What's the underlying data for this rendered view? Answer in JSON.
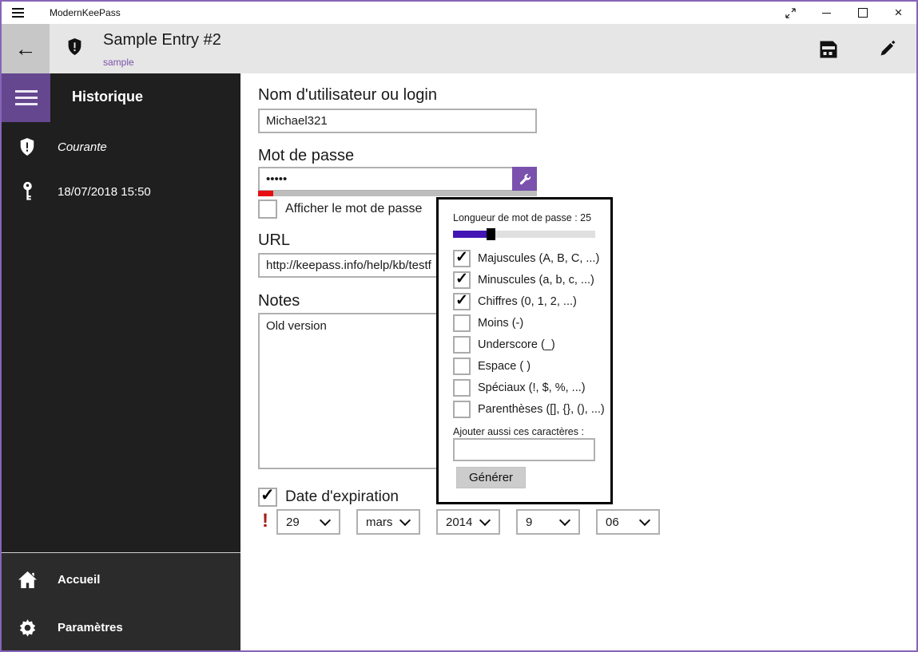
{
  "titlebar": {
    "app_title": "ModernKeePass"
  },
  "header": {
    "entry_title": "Sample Entry #2",
    "group_link": "sample"
  },
  "sidebar": {
    "heading": "Historique",
    "history_items": [
      {
        "label": "Courante",
        "icon": "shield-icon"
      },
      {
        "label": "18/07/2018 15:50",
        "icon": "key-icon"
      }
    ],
    "nav_items": [
      {
        "label": "Accueil",
        "icon": "home-icon"
      },
      {
        "label": "Paramètres",
        "icon": "gear-icon"
      }
    ]
  },
  "form": {
    "username": {
      "label": "Nom d'utilisateur ou login",
      "value": "Michael321"
    },
    "password": {
      "label": "Mot de passe",
      "value": "•••••"
    },
    "show_password": {
      "label": "Afficher le mot de passe",
      "checked": false
    },
    "url": {
      "label": "URL",
      "value": "http://keepass.info/help/kb/testf"
    },
    "notes": {
      "label": "Notes",
      "value": "Old version"
    },
    "expiration": {
      "label": "Date d'expiration",
      "checked": true
    },
    "date_parts": [
      {
        "name": "day",
        "value": "29"
      },
      {
        "name": "month",
        "value": "mars"
      },
      {
        "name": "year",
        "value": "2014"
      },
      {
        "name": "hour",
        "value": "9"
      },
      {
        "name": "minute",
        "value": "06"
      }
    ]
  },
  "generator": {
    "length_label": "Longueur de mot de passe : 25",
    "length_value": 25,
    "options": [
      {
        "label": "Majuscules (A, B, C, ...)",
        "checked": true
      },
      {
        "label": "Minuscules (a, b, c, ...)",
        "checked": true
      },
      {
        "label": "Chiffres (0, 1, 2, ...)",
        "checked": true
      },
      {
        "label": "Moins (-)",
        "checked": false
      },
      {
        "label": "Underscore (_)",
        "checked": false
      },
      {
        "label": "Espace ( )",
        "checked": false
      },
      {
        "label": "Spéciaux (!, $, %, ...)",
        "checked": false
      },
      {
        "label": "Parenthèses ([], {}, (), ...)",
        "checked": false
      }
    ],
    "custom_chars": {
      "label": "Ajouter aussi ces caractères :",
      "value": ""
    },
    "generate_button": "Générer"
  },
  "icons": {
    "back_arrow": "←",
    "close": "×",
    "warning": "!"
  },
  "colors": {
    "accent_purple": "#65478f",
    "accent_purple_light": "#7a52ad",
    "window_border": "#8764b8",
    "slider_fill": "#4316b4",
    "strength_red": "#e60e11",
    "warning_red": "#a52019",
    "sidebar_bg": "#1f1f1f",
    "sidebar_footer_bg": "#2b2b2b",
    "header_bg": "#e6e6e6"
  }
}
